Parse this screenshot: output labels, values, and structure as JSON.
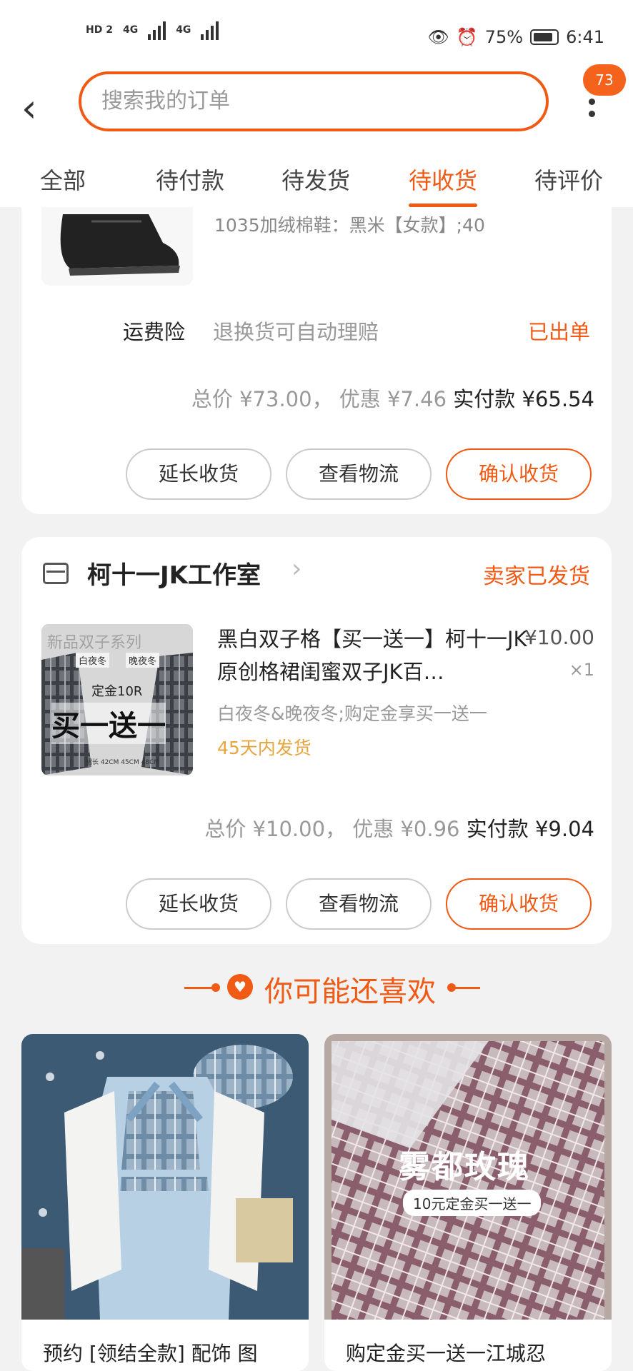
{
  "status_bar": {
    "network_left": "HD 2",
    "signal1": "4G",
    "signal2": "4G",
    "battery": "75%",
    "time": "6:41"
  },
  "header": {
    "search_placeholder": "搜索我的订单",
    "badge_count": "73"
  },
  "tabs": [
    {
      "label": "全部"
    },
    {
      "label": "待付款"
    },
    {
      "label": "待发货"
    },
    {
      "label": "待收货",
      "active": true
    },
    {
      "label": "待评价"
    }
  ],
  "order1": {
    "spec": "1035加绒棉鞋：黑米【女款】;40",
    "insurance_label": "运费险",
    "insurance_desc": "退换货可自动理赔",
    "insurance_status": "已出单",
    "total_label": "总价",
    "total_value": "¥73.00",
    "discount_label": "优惠",
    "discount_value": "¥7.46",
    "paid_label": "实付款",
    "paid_value": "¥65.54",
    "buttons": [
      "延长收货",
      "查看物流",
      "确认收货"
    ]
  },
  "order2": {
    "shop_name": "柯十一JK工作室",
    "shop_status": "卖家已发货",
    "product_title": "黑白双子格【买一送一】柯十一JK原创格裙闺蜜双子JK百…",
    "price": "¥10.00",
    "quantity": "×1",
    "spec": "白夜冬&晚夜冬;购定金享买一送一",
    "shipping_note": "45天内发货",
    "image_text": {
      "top": "新品双子系列",
      "label_left": "白夜冬",
      "label_right": "晚夜冬",
      "deposit": "定金10R",
      "promo": "买一送一",
      "sizes": "裙长 42CM 45CM 48CM"
    },
    "total_label": "总价",
    "total_value": "¥10.00",
    "discount_label": "优惠",
    "discount_value": "¥0.96",
    "paid_label": "实付款",
    "paid_value": "¥9.04",
    "buttons": [
      "延长收货",
      "查看物流",
      "确认收货"
    ]
  },
  "recommend": {
    "title": "你可能还喜欢",
    "items": [
      {
        "text": "预约 [领结全款] 配饰 图"
      },
      {
        "text": "购定金买一送一江城忍",
        "image_title": "雾都玫瑰",
        "image_sub": "10元定金买一送一"
      }
    ]
  },
  "colors": {
    "accent": "#f05a14",
    "ship_note": "#e8a53c"
  }
}
